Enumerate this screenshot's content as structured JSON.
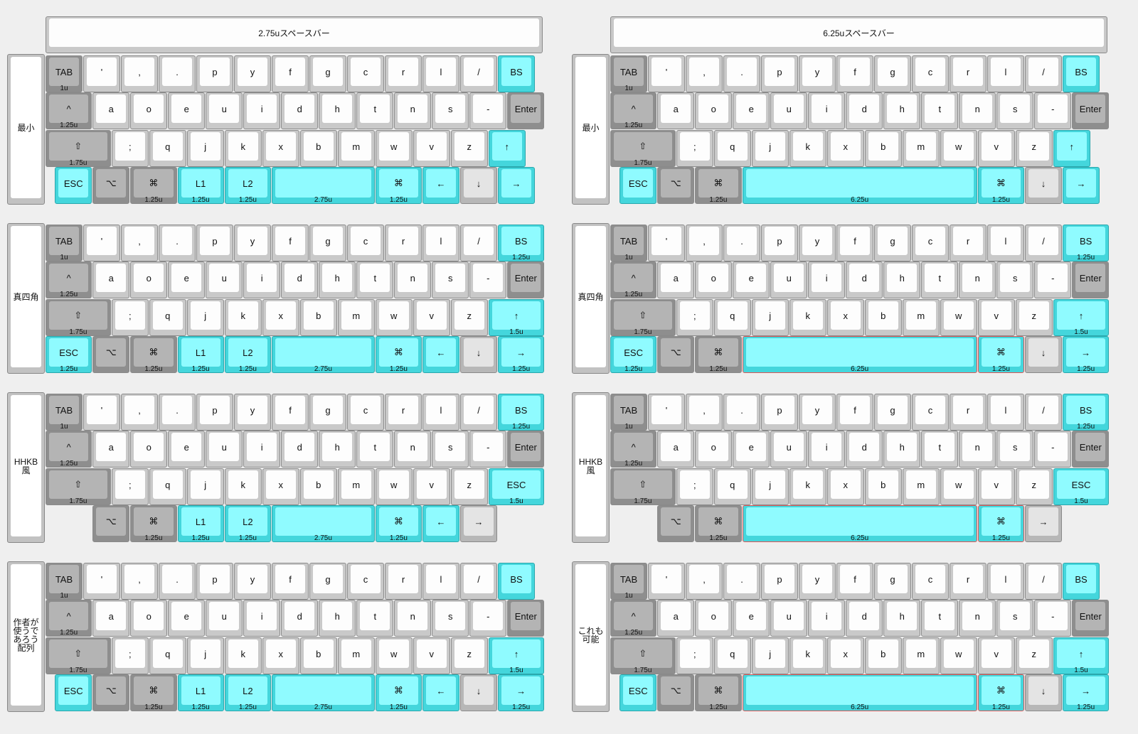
{
  "spacebar_labels": [
    "2.75uスペースバー",
    "6.25uスペースバー"
  ],
  "row_labels": [
    "最小",
    "真四角",
    "HHKB\n風",
    "作者が\n使うで\nあろう\n配列",
    "これも\n可能"
  ],
  "units": {
    "u1": "1u",
    "u125": "1.25u",
    "u15": "1.5u",
    "u175": "1.75u",
    "u275": "2.75u",
    "u625": "6.25u"
  },
  "keys": {
    "tab": "TAB",
    "bs": "BS",
    "ctrl": "^",
    "enter": "Enter",
    "shift": "⇧",
    "up": "↑",
    "esc": "ESC",
    "alt": "⌥",
    "cmd": "⌘",
    "l1": "L1",
    "l2": "L2",
    "left": "←",
    "down": "↓",
    "right": "→",
    "space": ""
  },
  "letters": {
    "row1": [
      "'",
      ",",
      ".",
      "p",
      "y",
      "f",
      "g",
      "c",
      "r",
      "l",
      "/"
    ],
    "row2": [
      "a",
      "o",
      "e",
      "u",
      "i",
      "d",
      "h",
      "t",
      "n",
      "s",
      "-"
    ],
    "row3": [
      ";",
      "q",
      "j",
      "k",
      "x",
      "b",
      "m",
      "w",
      "v",
      "z"
    ]
  },
  "colors": {
    "cyan": "#8ffbff",
    "gray": "#b4b4b4",
    "white": "#fdfdfd",
    "red_outline": "#e05555"
  }
}
